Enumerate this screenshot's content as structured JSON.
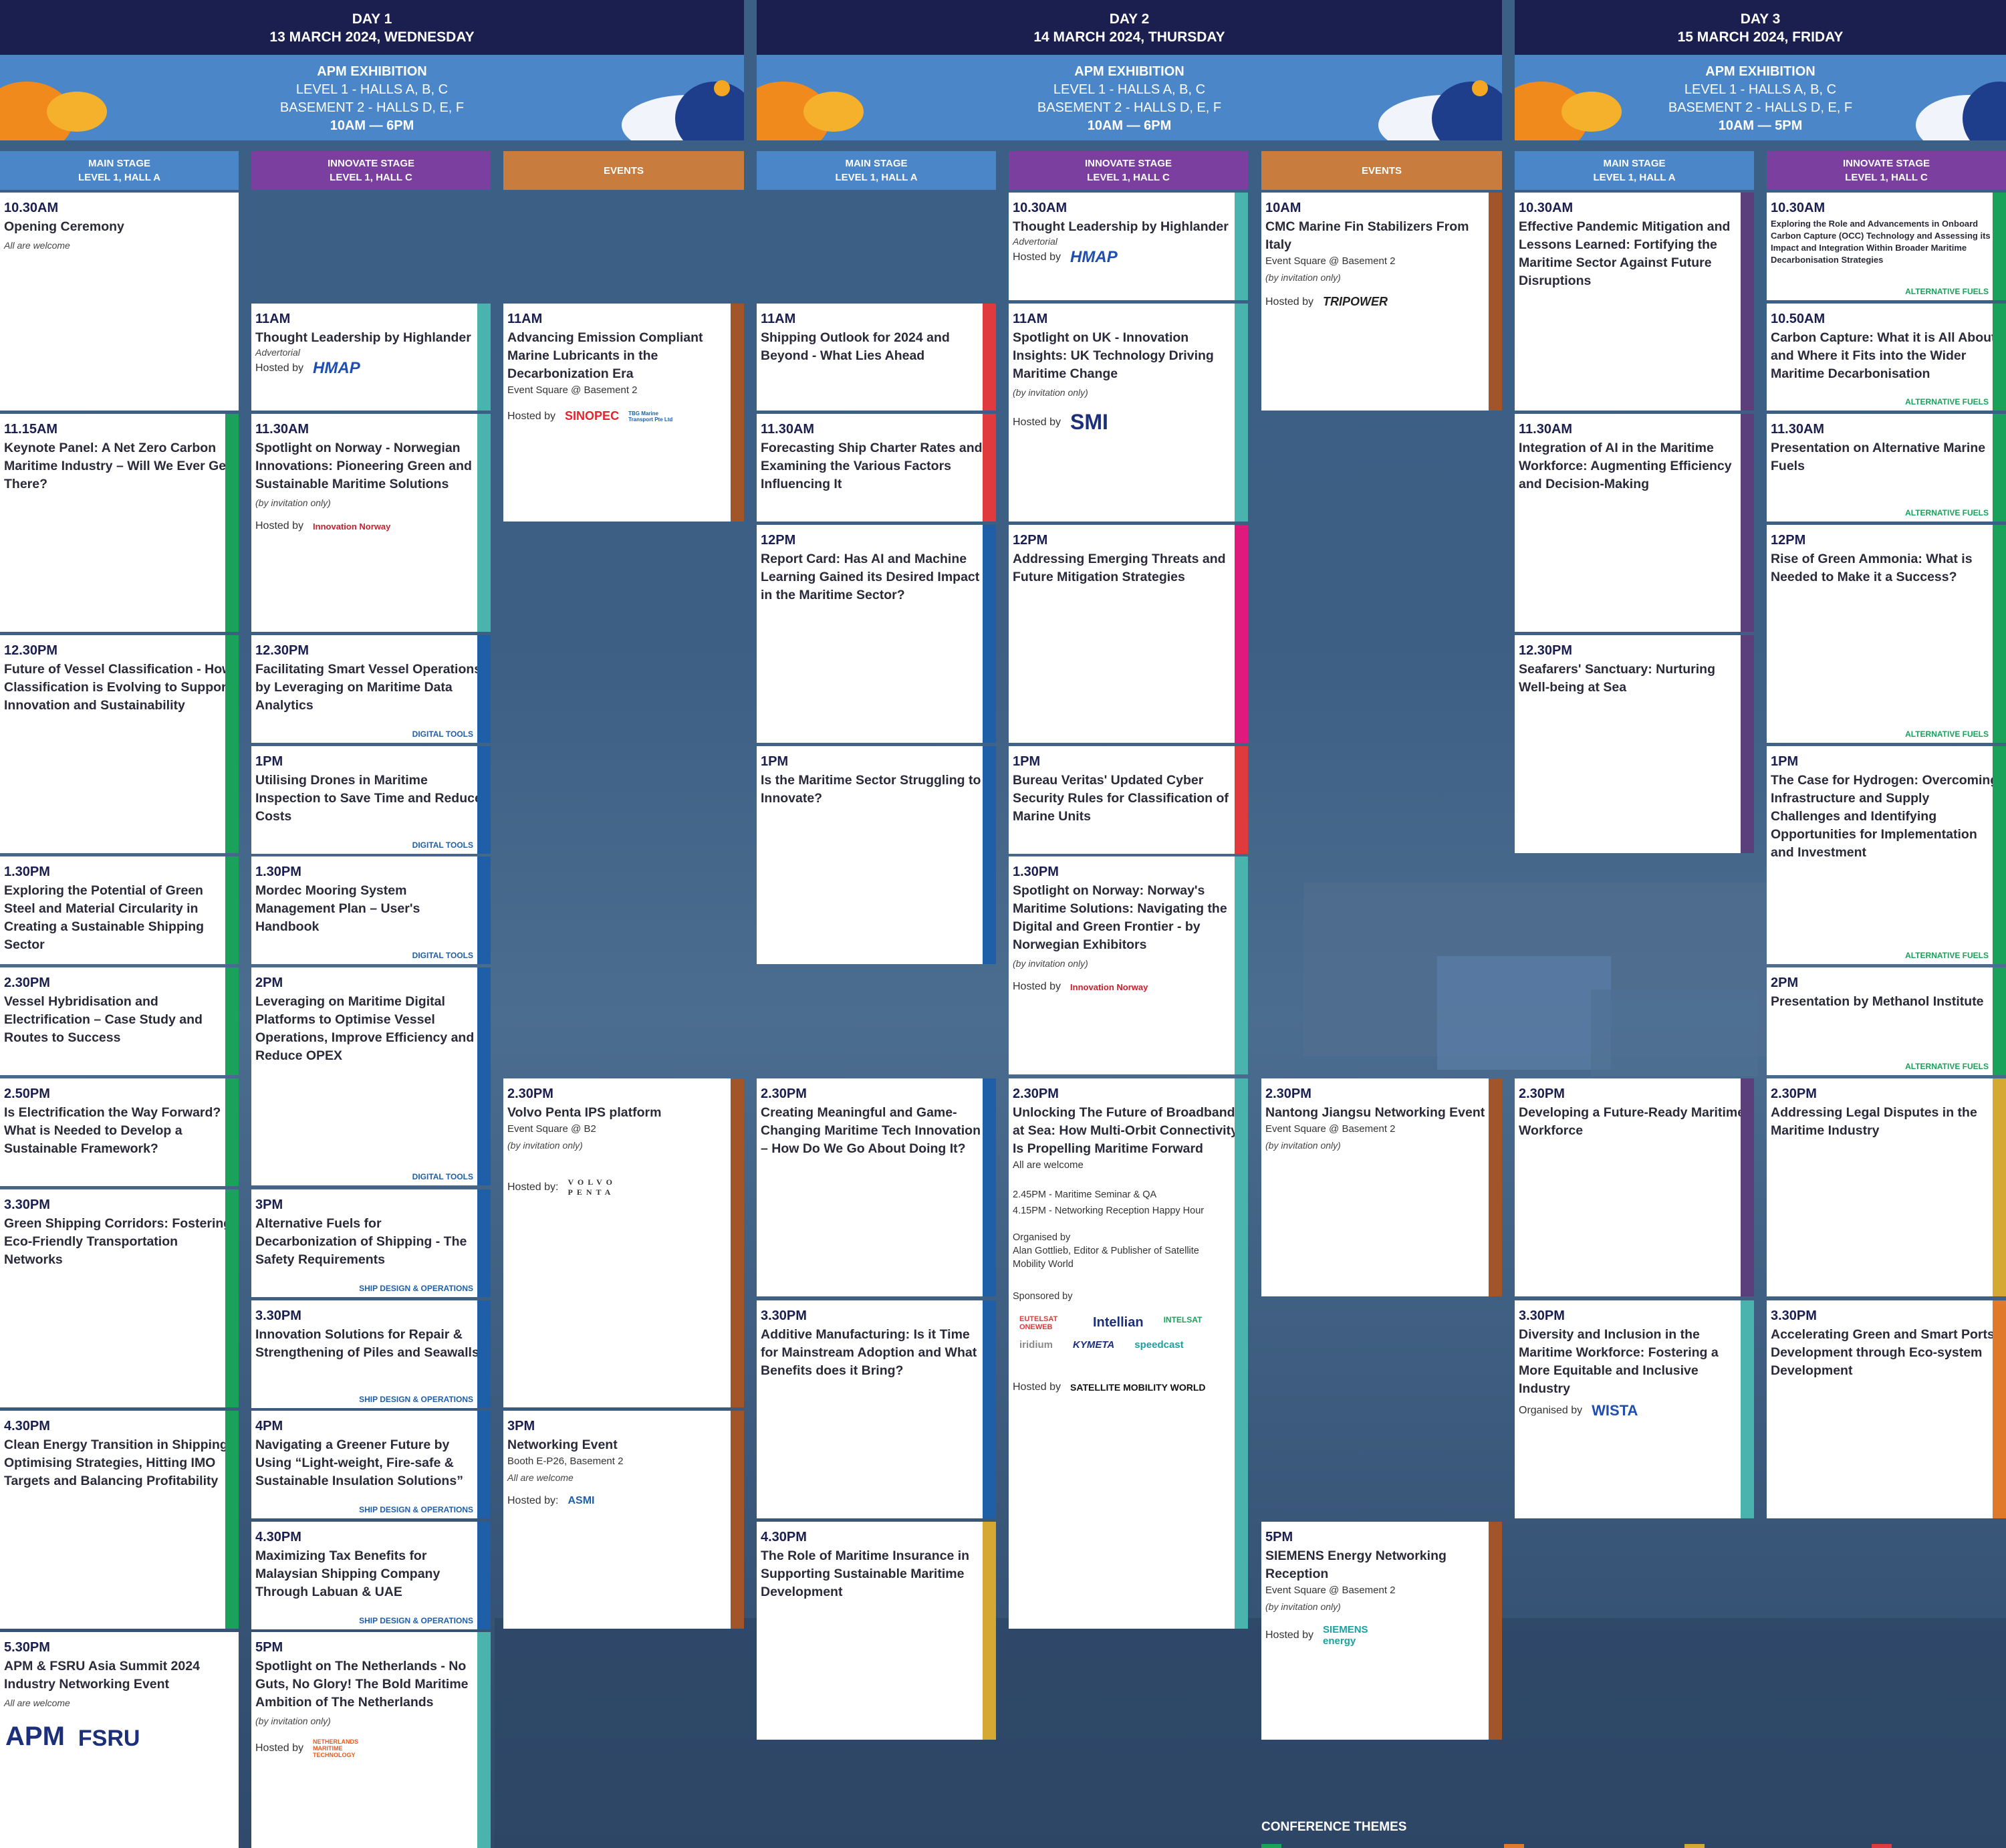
{
  "days": [
    {
      "day": "DAY 1",
      "date": "13 MARCH 2024, WEDNESDAY",
      "expo": "APM EXHIBITION",
      "l1": "LEVEL 1 - HALLS A, B, C",
      "l2": "BASEMENT 2 - HALLS D, E, F",
      "hours": "10AM — 6PM"
    },
    {
      "day": "DAY 2",
      "date": "14 MARCH 2024, THURSDAY",
      "expo": "APM EXHIBITION",
      "l1": "LEVEL 1 - HALLS A, B, C",
      "l2": "BASEMENT 2 - HALLS D, E, F",
      "hours": "10AM — 6PM"
    },
    {
      "day": "DAY 3",
      "date": "15 MARCH 2024, FRIDAY",
      "expo": "APM EXHIBITION",
      "l1": "LEVEL 1 - HALLS A, B, C",
      "l2": "BASEMENT 2 - HALLS D, E, F",
      "hours": "10AM — 5PM"
    }
  ],
  "columns": [
    {
      "l1": "MAIN STAGE",
      "l2": "LEVEL 1, HALL A"
    },
    {
      "l1": "INNOVATE STAGE",
      "l2": "LEVEL 1, HALL C"
    },
    {
      "l1": "EVENTS",
      "l2": ""
    },
    {
      "l1": "MAIN STAGE",
      "l2": "LEVEL 1, HALL A"
    },
    {
      "l1": "INNOVATE STAGE",
      "l2": "LEVEL 1, HALL C"
    },
    {
      "l1": "EVENTS",
      "l2": ""
    },
    {
      "l1": "MAIN STAGE",
      "l2": "LEVEL 1, HALL A"
    },
    {
      "l1": "INNOVATE STAGE",
      "l2": "LEVEL 1, HALL C"
    }
  ],
  "sessions": [
    {
      "time": "10.30AM",
      "title": "Opening Ceremony",
      "italic": "All are welcome"
    },
    {
      "time": "11.15AM",
      "title": "Keynote Panel: A Net Zero Carbon Maritime Industry – Will We Ever Get There?"
    },
    {
      "time": "12.30PM",
      "title": "Future of Vessel Classification - How Classification is Evolving to Support Innovation and Sustainability"
    },
    {
      "time": "1.30PM",
      "title": "Exploring the Potential of Green Steel and Material Circularity in Creating a Sustainable Shipping Sector"
    },
    {
      "time": "2.30PM",
      "title": "Vessel Hybridisation and Electrification – Case Study and Routes to Success"
    },
    {
      "time": "2.50PM",
      "title": "Is Electrification the Way Forward? What is Needed to Develop a Sustainable Framework?"
    },
    {
      "time": "3.30PM",
      "title": "Green Shipping Corridors: Fostering Eco-Friendly Transportation Networks"
    },
    {
      "time": "4.30PM",
      "title": "Clean Energy Transition in Shipping: Optimising Strategies, Hitting IMO Targets and Balancing Profitability"
    },
    {
      "time": "5.30PM",
      "title": "APM & FSRU Asia Summit 2024 Industry Networking Event",
      "italic": "All are welcome"
    },
    {
      "time": "11AM",
      "title": "Thought Leadership by Highlander",
      "italic": "Advertorial",
      "host": "Hosted by"
    },
    {
      "time": "11.30AM",
      "title": "Spotlight on Norway - Norwegian Innovations: Pioneering Green and Sustainable Maritime Solutions",
      "italic": "(by invitation only)",
      "host": "Hosted by"
    },
    {
      "time": "12.30PM",
      "title": "Facilitating Smart Vessel Operations by Leveraging on Maritime Data Analytics",
      "tag": "DIGITAL TOOLS"
    },
    {
      "time": "1PM",
      "title": "Utilising Drones in Maritime Inspection to Save Time and Reduce Costs",
      "tag": "DIGITAL TOOLS"
    },
    {
      "time": "1.30PM",
      "title": "Mordec Mooring System Management Plan – User's Handbook",
      "tag": "DIGITAL TOOLS"
    },
    {
      "time": "2PM",
      "title": "Leveraging on Maritime Digital Platforms to Optimise Vessel Operations, Improve Efficiency and Reduce OPEX",
      "tag": "DIGITAL TOOLS"
    },
    {
      "time": "3PM",
      "title": "Alternative Fuels for Decarbonization of Shipping - The Safety Requirements",
      "tag": "SHIP DESIGN & OPERATIONS"
    },
    {
      "time": "3.30PM",
      "title": "Innovation Solutions for Repair & Strengthening of Piles and Seawalls",
      "tag": "SHIP DESIGN & OPERATIONS"
    },
    {
      "time": "4PM",
      "title": "Navigating a Greener Future by Using “Light-weight, Fire-safe & Sustainable Insulation Solutions”",
      "tag": "SHIP DESIGN & OPERATIONS"
    },
    {
      "time": "4.30PM",
      "title": "Maximizing Tax Benefits for Malaysian Shipping Company Through Labuan & UAE",
      "tag": "SHIP DESIGN & OPERATIONS"
    },
    {
      "time": "5PM",
      "title": "Spotlight on The Netherlands - No Guts, No Glory! The Bold Maritime Ambition of The Netherlands",
      "italic": "(by invitation only)",
      "host": "Hosted by"
    },
    {
      "time": "11AM",
      "title": "Advancing Emission Compliant Marine Lubricants in the Decarbonization Era",
      "sub": "Event Square @ Basement 2",
      "host": "Hosted by"
    },
    {
      "time": "2.30PM",
      "title": "Volvo Penta IPS platform",
      "sub": "Event Square @ B2",
      "italic": "(by invitation only)",
      "host": "Hosted by:"
    },
    {
      "time": "3PM",
      "title": "Networking Event",
      "sub": "Booth E-P26, Basement 2",
      "italic": "All are welcome",
      "host": "Hosted by:"
    },
    {
      "time": "11AM",
      "title": "Shipping Outlook for 2024 and Beyond - What Lies Ahead"
    },
    {
      "time": "11.30AM",
      "title": "Forecasting Ship Charter Rates and Examining the Various Factors Influencing It"
    },
    {
      "time": "12PM",
      "title": "Report Card: Has AI and Machine Learning Gained its Desired Impact in the Maritime Sector?"
    },
    {
      "time": "1PM",
      "title": "Is the Maritime Sector Struggling to Innovate?"
    },
    {
      "time": "2.30PM",
      "title": "Creating Meaningful and Game-Changing Maritime Tech Innovation – How Do We Go About Doing It?"
    },
    {
      "time": "3.30PM",
      "title": "Additive Manufacturing: Is it Time for Mainstream Adoption and What Benefits does it Bring?"
    },
    {
      "time": "4.30PM",
      "title": "The Role of Maritime Insurance in Supporting Sustainable Maritime Development"
    },
    {
      "time": "10.30AM",
      "title": "Thought Leadership by Highlander",
      "italic": "Advertorial",
      "host": "Hosted by"
    },
    {
      "time": "11AM",
      "title": "Spotlight on UK - Innovation Insights: UK Technology Driving Maritime Change",
      "italic": "(by invitation only)",
      "host": "Hosted by"
    },
    {
      "time": "12PM",
      "title": "Addressing Emerging Threats and Future Mitigation Strategies"
    },
    {
      "time": "1PM",
      "title": "Bureau Veritas' Updated Cyber Security Rules for Classification of Marine Units"
    },
    {
      "time": "1.30PM",
      "title": "Spotlight on Norway: Norway's Maritime Solutions: Navigating the Digital and Green Frontier - by Norwegian Exhibitors",
      "italic": "(by invitation only)",
      "host": "Hosted by"
    },
    {
      "time": "2.30PM",
      "title": "Unlocking The Future of Broadband at Sea: How Multi-Orbit Connectivity Is Propelling Maritime Forward",
      "sub": "All are welcome",
      "x1": "2.45PM - Maritime Seminar & QA",
      "x2": "4.15PM - Networking Reception Happy Hour",
      "x3": "Organised by",
      "x4": "Alan Gottlieb, Editor & Publisher of Satellite Mobility World",
      "x5": "Sponsored by",
      "host": "Hosted by"
    },
    {
      "time": "10AM",
      "title": "CMC Marine Fin Stabilizers From Italy",
      "sub": "Event Square @ Basement 2",
      "italic": "(by invitation only)",
      "host": "Hosted by"
    },
    {
      "time": "2.30PM",
      "title": "Nantong Jiangsu Networking Event",
      "sub": "Event Square @ Basement 2",
      "italic": "(by invitation only)"
    },
    {
      "time": "5PM",
      "title": "SIEMENS Energy Networking Reception",
      "sub": "Event Square @ Basement 2",
      "italic": "(by invitation only)",
      "host": "Hosted by"
    },
    {
      "time": "10.30AM",
      "title": "Effective Pandemic Mitigation and Lessons Learned: Fortifying the Maritime Sector Against Future Disruptions"
    },
    {
      "time": "11.30AM",
      "title": "Integration of AI in the Maritime Workforce: Augmenting Efficiency and Decision-Making"
    },
    {
      "time": "12.30PM",
      "title": "Seafarers' Sanctuary: Nurturing Well-being at Sea"
    },
    {
      "time": "2.30PM",
      "title": "Developing a Future-Ready Maritime Workforce"
    },
    {
      "time": "3.30PM",
      "title": "Diversity and Inclusion in the Maritime Workforce: Fostering a More Equitable and Inclusive Industry",
      "host": "Organised by"
    },
    {
      "time": "10.30AM",
      "title": "Exploring the Role and Advancements in Onboard Carbon Capture (OCC) Technology and Assessing its Impact and Integration Within Broader Maritime Decarbonisation Strategies",
      "tag": "ALTERNATIVE FUELS"
    },
    {
      "time": "10.50AM",
      "title": "Carbon Capture: What it is All About and Where it Fits into the Wider Maritime Decarbonisation",
      "tag": "ALTERNATIVE FUELS"
    },
    {
      "time": "11.30AM",
      "title": "Presentation on Alternative Marine Fuels",
      "tag": "ALTERNATIVE FUELS"
    },
    {
      "time": "12PM",
      "title": "Rise of Green Ammonia: What is Needed to Make it a Success?",
      "tag": "ALTERNATIVE FUELS"
    },
    {
      "time": "1PM",
      "title": "The Case for Hydrogen: Overcoming Infrastructure and Supply Challenges and Identifying Opportunities for Implementation and Investment",
      "tag": "ALTERNATIVE FUELS"
    },
    {
      "time": "2PM",
      "title": "Presentation by Methanol Institute",
      "tag": "ALTERNATIVE FUELS"
    },
    {
      "time": "2.30PM",
      "title": "Addressing Legal Disputes in the Maritime Industry"
    },
    {
      "time": "3.30PM",
      "title": "Accelerating Green and Smart Ports Development through Eco-system Development"
    }
  ],
  "logos": {
    "hmap": "HMAP",
    "innovation_norway": "Innovation Norway",
    "sinopec": "SINOPEC",
    "tbg": "TBG Marine Transport Pte Ltd",
    "smi": "SMI",
    "tripower": "TRIPOWER",
    "volvo": "VOLVO PENTA",
    "asmi": "ASMI",
    "siemens": "SIEMENS energy",
    "apm": "APM",
    "fsru": "FSRU",
    "nl": "NETHERLANDS MARITIME TECHNOLOGY",
    "wista": "WISTA",
    "smw": "SATELLITE MOBILITY WORLD",
    "eutelsat": "EUTELSAT ONEWEB",
    "intellian": "Intellian",
    "intelsat": "INTELSAT",
    "iridium": "iridium",
    "kymeta": "KYMETA",
    "speedcast": "speedcast"
  },
  "themes": "CONFERENCE THEMES",
  "colors": {
    "navy": "#1b1f4f",
    "main": "#4a86c8",
    "innovate": "#7b3fa0",
    "events": "#c87c3e",
    "green": "#1aa15a",
    "blue": "#1f5fa8",
    "teal": "#4ab3ad",
    "red": "#e0393e",
    "magenta": "#e0197d",
    "purple": "#5a3f7a",
    "brown": "#a3552a",
    "gold": "#d4a832",
    "orange": "#e07a2a"
  }
}
